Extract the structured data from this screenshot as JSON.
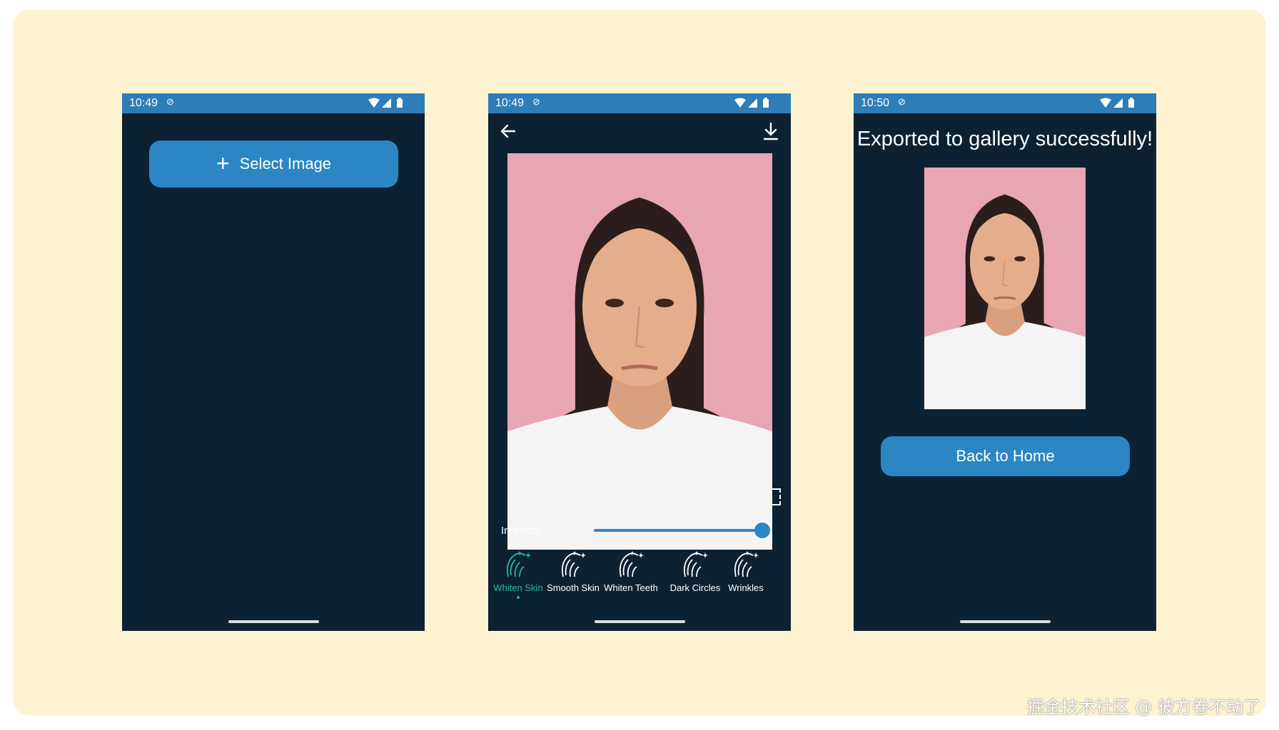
{
  "screens": [
    {
      "status": {
        "time": "10:49",
        "notif_icon": "location-icon",
        "sys_icons": [
          "wifi-icon",
          "signal-icon",
          "battery-icon"
        ]
      },
      "select_button": {
        "label": "Select Image",
        "icon": "plus-icon"
      }
    },
    {
      "status": {
        "time": "10:49",
        "notif_icon": "location-icon",
        "sys_icons": [
          "wifi-icon",
          "signal-icon",
          "battery-icon"
        ]
      },
      "toolbar": {
        "back_icon": "arrow-left-icon",
        "save_icon": "download-icon"
      },
      "intensity": {
        "label": "Intensity",
        "value": 1.0
      },
      "tools": [
        {
          "label": "Whiten Skin",
          "active": true
        },
        {
          "label": "Smooth Skin",
          "active": false
        },
        {
          "label": "Whiten Teeth",
          "active": false
        },
        {
          "label": "Dark Circles",
          "active": false
        },
        {
          "label": "Wrinkles",
          "active": false
        }
      ]
    },
    {
      "status": {
        "time": "10:50",
        "notif_icon": "location-icon",
        "sys_icons": [
          "wifi-icon",
          "signal-icon",
          "battery-icon"
        ]
      },
      "title": "Exported to gallery successfully!",
      "back_button": {
        "label": "Back to Home"
      }
    }
  ],
  "watermark": "掘金技术社区 @ 彼方卷不动了",
  "colors": {
    "background": "#fdf3d1",
    "phone_bg": "#0c2233",
    "status_bar": "#2e7db8",
    "accent": "#2d86c4",
    "active_tool": "#2bb3a8",
    "photo_bg": "#e8a5b3"
  }
}
